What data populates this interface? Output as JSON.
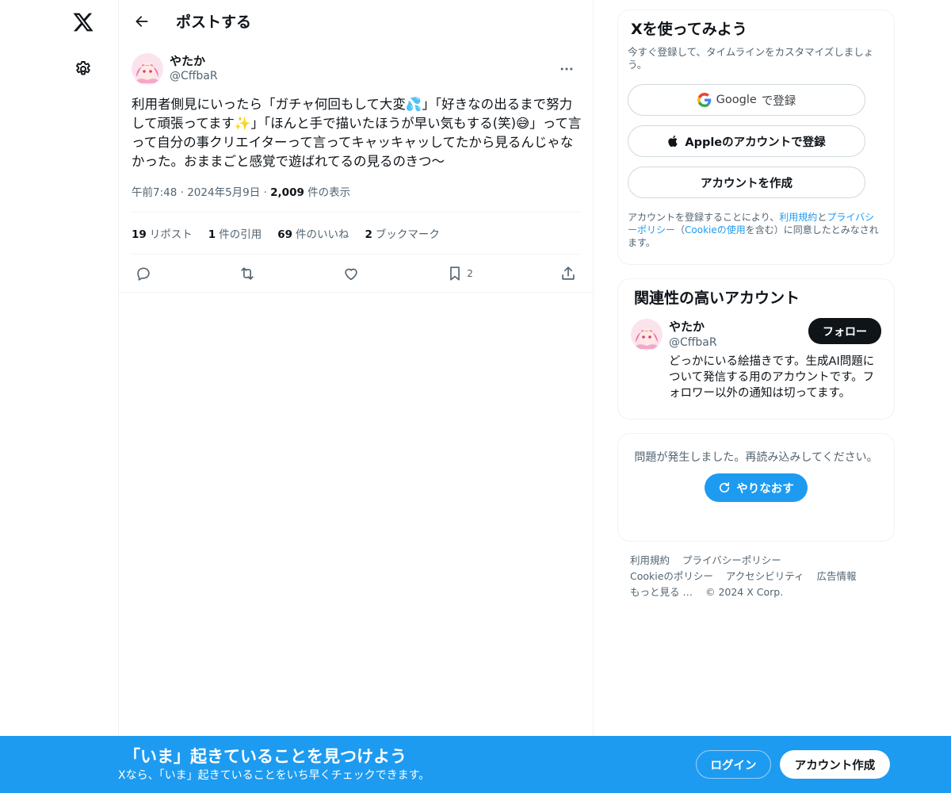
{
  "header": {
    "title": "ポストする"
  },
  "tweet": {
    "author_name": "やたか",
    "author_handle": "@CffbaR",
    "text": "利用者側見にいったら「ガチャ何回もして大変💦」「好きなの出るまで努力して頑張ってます✨」「ほんと手で描いたほうが早い気もする(笑)😅」って言って自分の事クリエイターって言ってキャッキャッしてたから見るんじゃなかった。おままごと感覚で遊ばれてるの見るのきつ〜",
    "time": "午前7:48",
    "date": "2024年5月9日",
    "views_count": "2,009",
    "views_label": "件の表示",
    "stats": {
      "reposts": {
        "count": "19",
        "label": "リポスト"
      },
      "quotes": {
        "count": "1",
        "label": "件の引用"
      },
      "likes": {
        "count": "69",
        "label": "件のいいね"
      },
      "bookmarks": {
        "count": "2",
        "label": "ブックマーク"
      }
    },
    "bookmark_action_count": "2"
  },
  "signup_card": {
    "title": "Xを使ってみよう",
    "subtitle": "今すぐ登録して、タイムラインをカスタマイズしましょう。",
    "google_brand": "Google",
    "google_suffix": "で登録",
    "apple_label": "Appleのアカウントで登録",
    "create_label": "アカウントを作成",
    "legal_prefix": "アカウントを登録することにより、",
    "legal_terms": "利用規約",
    "legal_and": "と",
    "legal_privacy": "プライバシーポリシー",
    "legal_paren_open": "（",
    "legal_cookie": "Cookieの使用",
    "legal_suffix": "を含む）に同意したとみなされます。"
  },
  "related_card": {
    "title": "関連性の高いアカウント",
    "name": "やたか",
    "handle": "@CffbaR",
    "follow_label": "フォロー",
    "bio": "どっかにいる絵描きです。生成AI問題について発信する用のアカウントです。フォロワー以外の通知は切ってます。"
  },
  "error_card": {
    "text": "問題が発生しました。再読み込みしてください。",
    "retry_label": "やりなおす"
  },
  "footer": {
    "terms": "利用規約",
    "privacy": "プライバシーポリシー",
    "cookie": "Cookieのポリシー",
    "accessibility": "アクセシビリティ",
    "ads": "広告情報",
    "more": "もっと見る …",
    "copyright": "© 2024 X Corp."
  },
  "banner": {
    "title": "「いま」起きていることを見つけよう",
    "subtitle": "Xなら、「いま」起きていることをいち早くチェックできます。",
    "login_label": "ログイン",
    "signup_label": "アカウント作成"
  },
  "colors": {
    "accent": "#1d9bf0",
    "text_primary": "#0f1419",
    "text_secondary": "#536471",
    "border": "#eff3f4"
  },
  "icons": {
    "logo": "x-logo-icon",
    "settings": "gear-icon",
    "back": "arrow-left-icon",
    "more": "more-dots-icon",
    "reply": "reply-icon",
    "repost": "repost-icon",
    "like": "heart-icon",
    "bookmark": "bookmark-icon",
    "share": "share-icon",
    "google": "google-icon",
    "apple": "apple-icon",
    "retry": "refresh-icon"
  }
}
